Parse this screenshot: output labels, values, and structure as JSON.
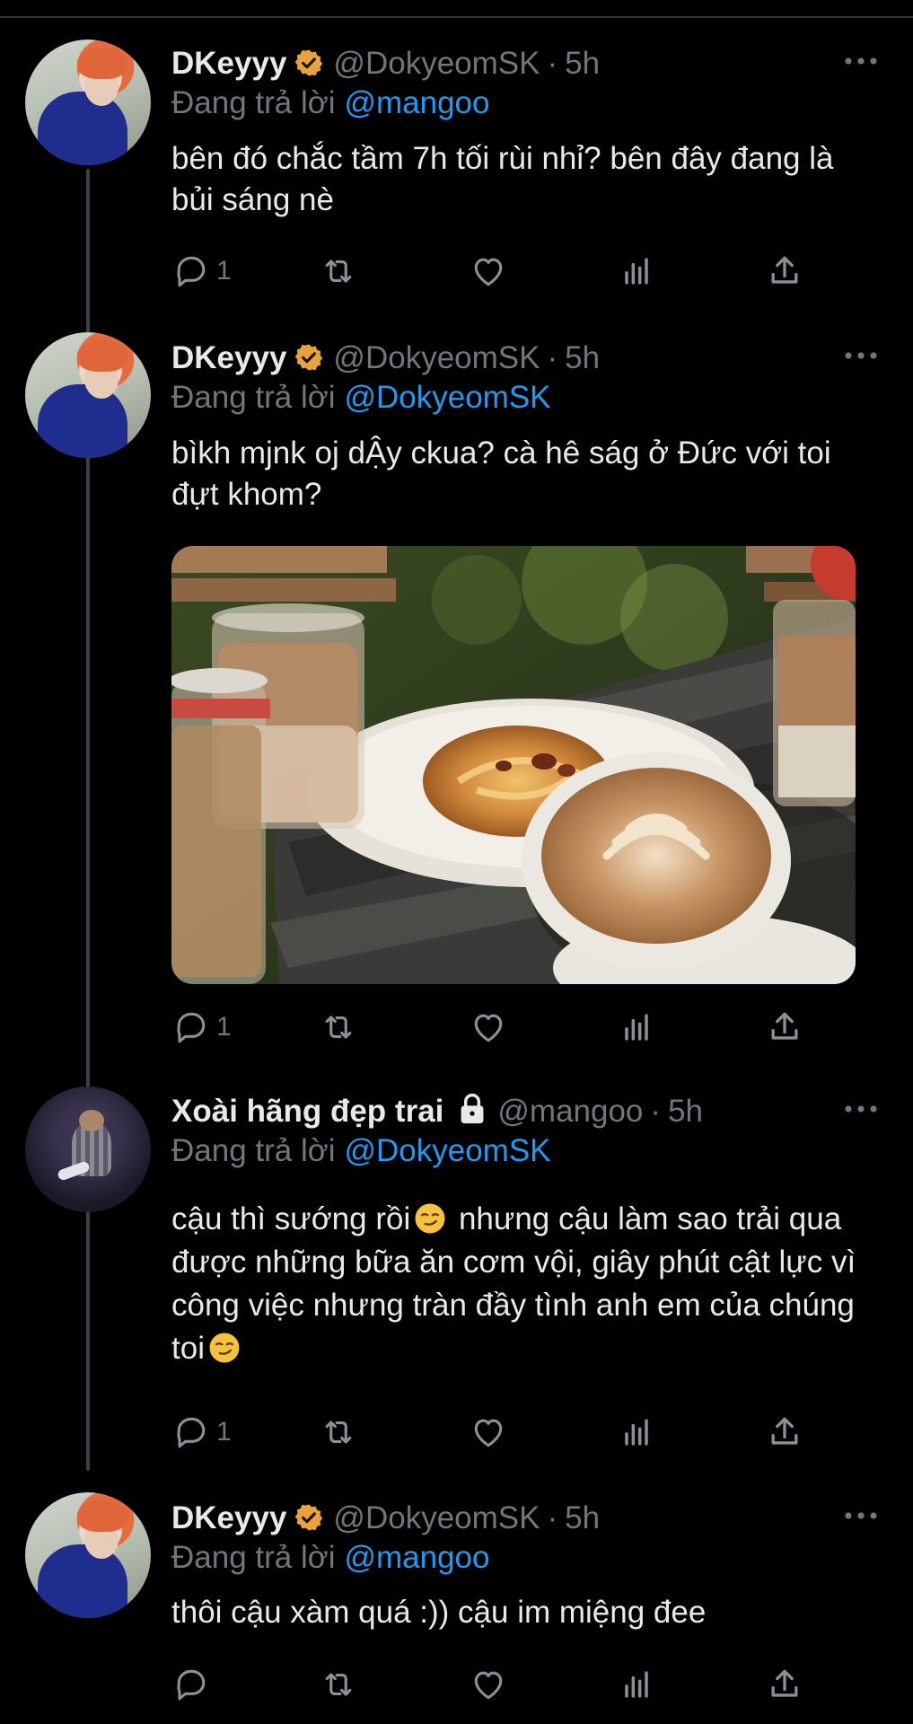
{
  "colors": {
    "background": "#000000",
    "text": "#e7e9ea",
    "secondary": "#71767b",
    "link": "#1d9bf0",
    "verified": "#e8a33b",
    "thread_line": "#3e4144"
  },
  "icons": {
    "reply": "speech-bubble-icon",
    "retweet": "retweet-arrows-icon",
    "like": "heart-icon",
    "views": "bar-chart-icon",
    "share": "share-upload-icon",
    "more": "three-dots-icon",
    "verified": "gold-verified-badge-icon",
    "protected": "lock-icon"
  },
  "tweets": [
    {
      "display_name": "DKeyyy",
      "handle": "@DokyeomSK",
      "separator": "·",
      "time": "5h",
      "reply_prefix": "Đang trả lời",
      "reply_to": "@mangoo",
      "text": "bên đó chắc tầm 7h tối rùi nhỉ? bên đây đang là bủi sáng nè",
      "reply_count": "1"
    },
    {
      "display_name": "DKeyyy",
      "handle": "@DokyeomSK",
      "separator": "·",
      "time": "5h",
      "reply_prefix": "Đang trả lời",
      "reply_to": "@DokyeomSK",
      "text": "bìkh mjnk oj dẬy ckua? cà hê ság ở Đức với toi đựt khom?",
      "reply_count": "1"
    },
    {
      "display_name": "Xoài hãng đẹp trai",
      "handle": "@mangoo",
      "separator": "·",
      "time": "5h",
      "reply_prefix": "Đang trả lời",
      "reply_to": "@DokyeomSK",
      "text_part1": "cậu thì sướng rồi",
      "text_part2": "nhưng cậu làm sao trải qua được những bữa ăn cơm vội, giây phút cật lực vì công việc nhưng tràn đầy tình anh em của chúng toi",
      "emoji": "smirking-face",
      "reply_count": "1"
    },
    {
      "display_name": "DKeyyy",
      "handle": "@DokyeomSK",
      "separator": "·",
      "time": "5h",
      "reply_prefix": "Đang trả lời",
      "reply_to": "@mangoo",
      "text": "thôi cậu xàm quá :)) cậu im miệng đee",
      "reply_count": ""
    }
  ]
}
